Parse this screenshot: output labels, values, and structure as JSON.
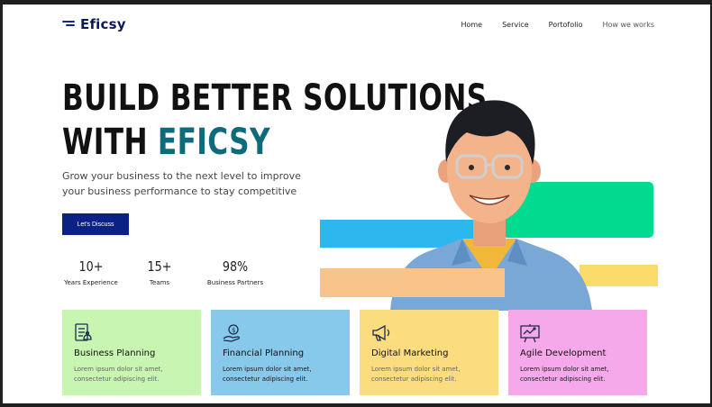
{
  "header": {
    "logo_text": "Eficsy",
    "nav": [
      "Home",
      "Service",
      "Portofolio",
      "How we works"
    ]
  },
  "hero": {
    "title_line1": "BUILD BETTER SOLUTIONS",
    "title_line2_prefix": "WITH",
    "title_line2_accent": "EFICSY",
    "subtitle": "Grow your business to the next level to improve your business performance to stay competitive",
    "cta_label": "Let's Discuss"
  },
  "stats": [
    {
      "value": "10+",
      "label": "Years Experience"
    },
    {
      "value": "15+",
      "label": "Teams"
    },
    {
      "value": "98%",
      "label": "Business Partners"
    }
  ],
  "services": [
    {
      "title": "Business Planning",
      "desc_line1": "Lorem ipsum dolor sit amet,",
      "desc_line2": "consectetur adipiscing elit.",
      "bg": "#c8f5b1",
      "icon": "checklist-icon"
    },
    {
      "title": "Financial Planning",
      "desc_line1": "Lorem ipsum dolor sit amet,",
      "desc_line2": "consectetur adipiscing elit.",
      "bg": "#86c9ea",
      "icon": "money-hand-icon"
    },
    {
      "title": "Digital Marketing",
      "desc_line1": "Lorem ipsum dolor sit amet,",
      "desc_line2": "consectetur adipiscing elit.",
      "bg": "#fbdc7e",
      "icon": "megaphone-icon"
    },
    {
      "title": "Agile Development",
      "desc_line1": "Lorem ipsum dolor sit amet,",
      "desc_line2": "consectetur adipiscing elit.",
      "bg": "#f6a9ea",
      "icon": "presentation-board-icon"
    }
  ],
  "colors": {
    "brand_navy": "#0b2185",
    "accent_teal": "#0d6b7c",
    "shape_blue": "#2db7ef",
    "shape_green": "#00db8f",
    "shape_peach": "#f8c48a",
    "shape_yellow": "#fbdc6a"
  }
}
